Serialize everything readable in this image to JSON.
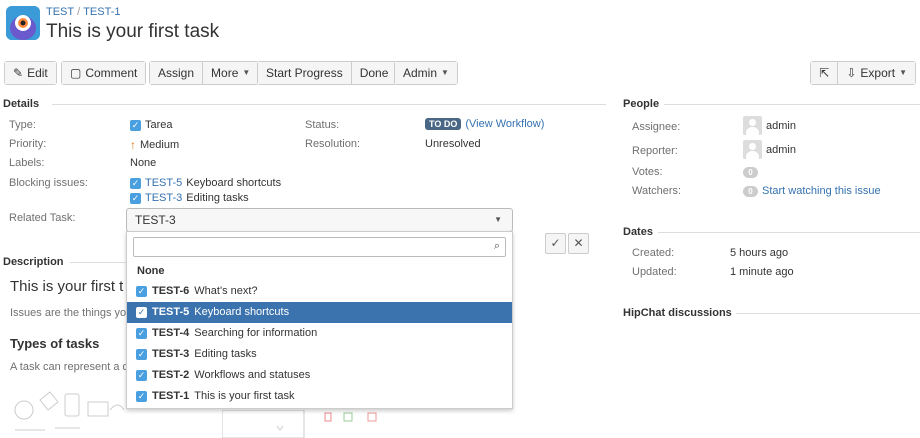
{
  "breadcrumb": {
    "project": "TEST",
    "sep": "/",
    "issue": "TEST-1"
  },
  "title": "This is your first task",
  "toolbar": {
    "edit": "Edit",
    "comment": "Comment",
    "assign": "Assign",
    "more": "More",
    "start_progress": "Start Progress",
    "done": "Done",
    "admin": "Admin",
    "export": "Export"
  },
  "details": {
    "heading": "Details",
    "type_label": "Type:",
    "type_value": "Tarea",
    "priority_label": "Priority:",
    "priority_value": "Medium",
    "labels_label": "Labels:",
    "labels_value": "None",
    "blocking_label": "Blocking issues:",
    "blocking": [
      {
        "key": "TEST-5",
        "summary": "Keyboard shortcuts"
      },
      {
        "key": "TEST-3",
        "summary": "Editing tasks"
      }
    ],
    "related_label": "Related Task:",
    "status_label": "Status:",
    "status_value": "TO DO",
    "view_workflow": "(View Workflow)",
    "resolution_label": "Resolution:",
    "resolution_value": "Unresolved"
  },
  "related_select": {
    "selected": "TEST-3",
    "search_value": "",
    "none_label": "None",
    "options": [
      {
        "key": "TEST-6",
        "summary": "What's next?",
        "active": false
      },
      {
        "key": "TEST-5",
        "summary": "Keyboard shortcuts",
        "active": true
      },
      {
        "key": "TEST-4",
        "summary": "Searching for information",
        "active": false
      },
      {
        "key": "TEST-3",
        "summary": "Editing tasks",
        "active": false
      },
      {
        "key": "TEST-2",
        "summary": "Workflows and statuses",
        "active": false
      },
      {
        "key": "TEST-1",
        "summary": "This is your first task",
        "active": false
      }
    ]
  },
  "description": {
    "heading": "Description",
    "title": "This is your first t",
    "text": "Issues are the things yo",
    "types_heading": "Types of tasks",
    "types_text": "A task can represent a d"
  },
  "people": {
    "heading": "People",
    "assignee_label": "Assignee:",
    "assignee": "admin",
    "reporter_label": "Reporter:",
    "reporter": "admin",
    "votes_label": "Votes:",
    "votes": "0",
    "watchers_label": "Watchers:",
    "watchers": "0",
    "start_watching": "Start watching this issue"
  },
  "dates": {
    "heading": "Dates",
    "created_label": "Created:",
    "created": "5 hours ago",
    "updated_label": "Updated:",
    "updated": "1 minute ago"
  },
  "hipchat": {
    "heading": "HipChat discussions"
  },
  "colors": {
    "link": "#3572b0",
    "active_row": "#3b73af",
    "lozenge": "#4a6785",
    "checkbox": "#4a9fe0"
  }
}
